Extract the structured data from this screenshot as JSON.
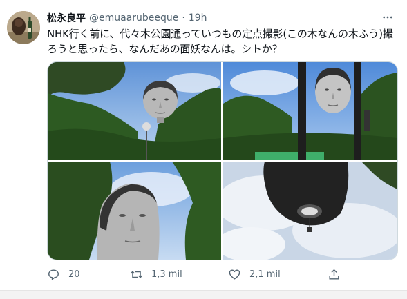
{
  "tweet": {
    "author_name": "松永良平",
    "handle": "@emuaarubeeque",
    "separator": "·",
    "time": "19h",
    "text": "NHK行く前に、代々木公園通っていつもの定点撮影(この木なんの木ふう)撮ろうと思ったら、なんだあの面妖なんは。シトか？"
  },
  "actions": {
    "reply_count": "20",
    "retweet_count": "1,3 mil",
    "like_count": "2,1 mil"
  },
  "icons": [
    "more-icon",
    "reply-icon",
    "retweet-icon",
    "like-icon",
    "share-icon"
  ],
  "colors": {
    "text": "#0f1419",
    "secondary": "#536471",
    "border": "#cfd9de"
  }
}
